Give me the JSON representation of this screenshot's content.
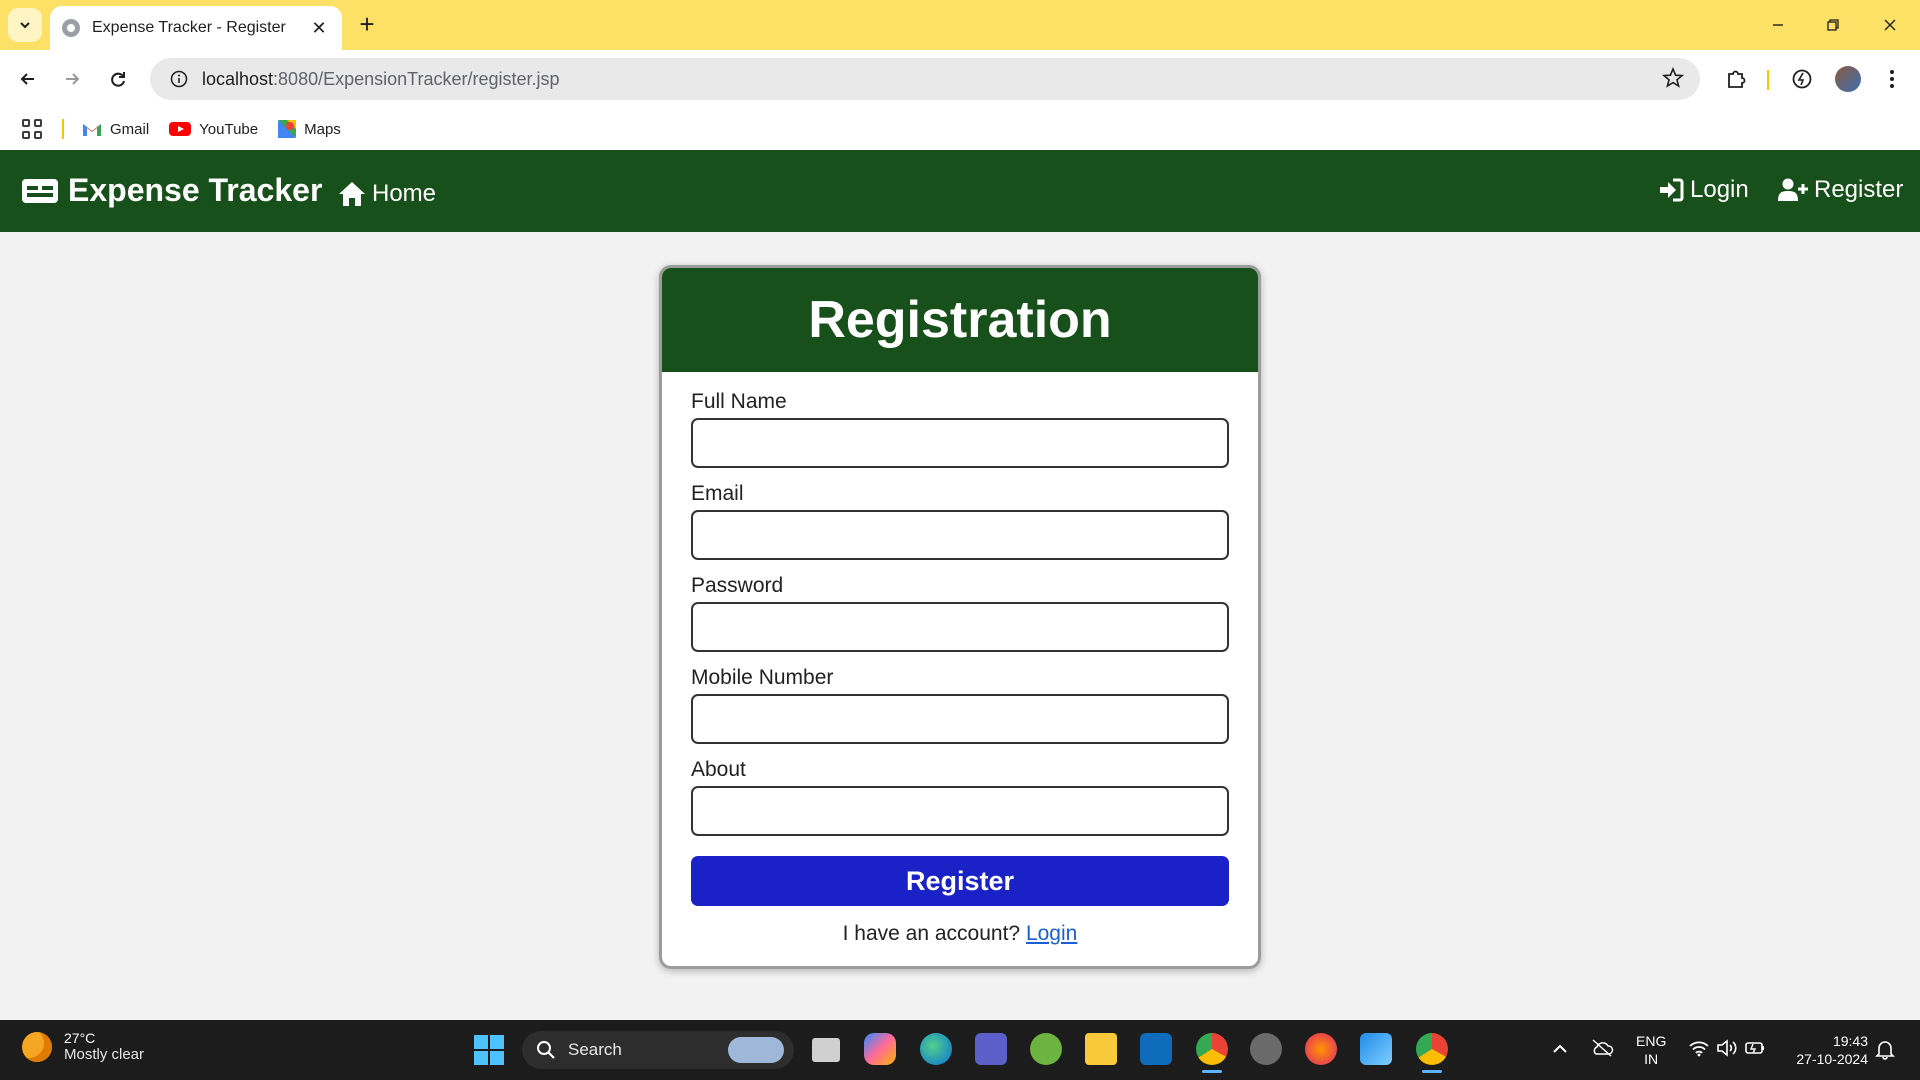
{
  "browser": {
    "tab_title": "Expense Tracker - Register",
    "url_host": "localhost",
    "url_rest": ":8080/ExpensionTracker/register.jsp",
    "bookmarks": [
      "Gmail",
      "YouTube",
      "Maps"
    ]
  },
  "navbar": {
    "brand": "Expense Tracker",
    "home": "Home",
    "login": "Login",
    "register": "Register",
    "color": "#17501a"
  },
  "form": {
    "title": "Registration",
    "fields": [
      {
        "label": "Full Name",
        "value": ""
      },
      {
        "label": "Email",
        "value": ""
      },
      {
        "label": "Password",
        "value": ""
      },
      {
        "label": "Mobile Number",
        "value": ""
      },
      {
        "label": "About",
        "value": ""
      }
    ],
    "submit_label": "Register",
    "submit_color": "#1a21c6",
    "account_prompt": "I have an account?",
    "login_link": "Login"
  },
  "taskbar": {
    "temperature": "27°C",
    "weather": "Mostly clear",
    "search": "Search",
    "lang_top": "ENG",
    "lang_bottom": "IN",
    "time": "19:43",
    "date": "27-10-2024"
  }
}
